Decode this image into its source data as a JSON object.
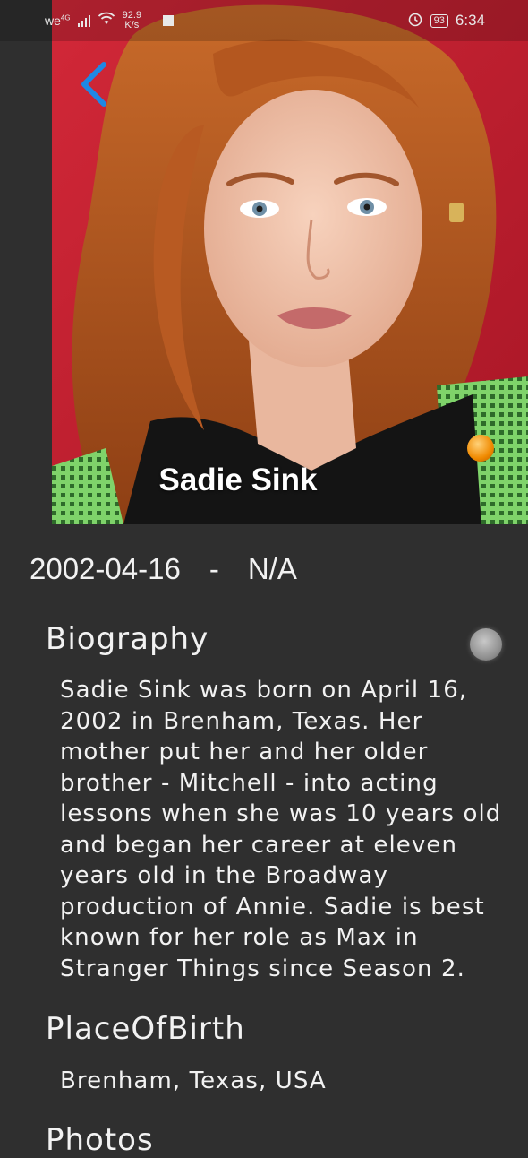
{
  "status_bar": {
    "carrier": "we",
    "network_type": "4G",
    "net_speed_value": "92.9",
    "net_speed_unit": "K/s",
    "battery": "93",
    "time": "6:34"
  },
  "profile": {
    "name": "Sadie Sink",
    "birthday": "2002-04-16",
    "separator": "-",
    "deathday": "N/A"
  },
  "biography": {
    "title": "Biography",
    "text": "Sadie Sink was born on April 16, 2002 in Brenham, Texas. Her mother put her and her older brother - Mitchell - into acting lessons when she was 10 years old and began her career at eleven years old in the Broadway production of Annie. Sadie is best known for her role as Max in Stranger Things since Season 2."
  },
  "place_of_birth": {
    "title": "PlaceOfBirth",
    "value": "Brenham, Texas, USA"
  },
  "photos": {
    "title": "Photos"
  },
  "colors": {
    "background": "#2f2f2f",
    "accent_back_arrow": "#1e88e5",
    "hero_background": "#c41f30"
  }
}
